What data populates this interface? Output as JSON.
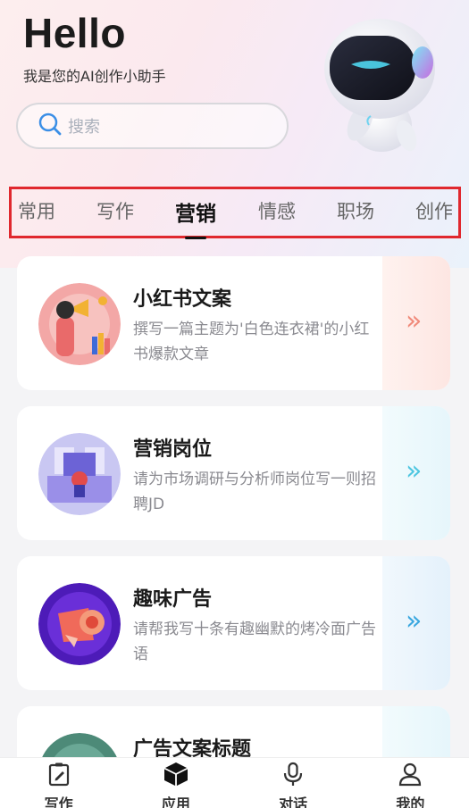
{
  "header": {
    "greeting": "Hello",
    "subtitle": "我是您的AI创作小助手"
  },
  "search": {
    "placeholder": "搜索"
  },
  "tabs": [
    {
      "label": "常用",
      "active": false
    },
    {
      "label": "写作",
      "active": false
    },
    {
      "label": "营销",
      "active": true
    },
    {
      "label": "情感",
      "active": false
    },
    {
      "label": "职场",
      "active": false
    },
    {
      "label": "创作",
      "active": false
    }
  ],
  "cards": [
    {
      "title": "小红书文案",
      "desc": "撰写一篇主题为'白色连衣裙'的小红书爆款文章",
      "accent": "#f08a7a"
    },
    {
      "title": "营销岗位",
      "desc": "请为市场调研与分析师岗位写一则招聘JD",
      "accent": "#4ec6e0"
    },
    {
      "title": "趣味广告",
      "desc": "请帮我写十条有趣幽默的烤冷面广告语",
      "accent": "#3aa7df"
    },
    {
      "title": "广告文案标题",
      "desc": "",
      "accent": "#4ec6e0"
    }
  ],
  "nav": [
    {
      "label": "写作",
      "icon": "edit-icon"
    },
    {
      "label": "应用",
      "icon": "cube-icon"
    },
    {
      "label": "对话",
      "icon": "microphone-icon"
    },
    {
      "label": "我的",
      "icon": "user-icon"
    }
  ],
  "colors": {
    "tab_highlight_border": "#e0282e",
    "background": "#f4f4f6"
  }
}
